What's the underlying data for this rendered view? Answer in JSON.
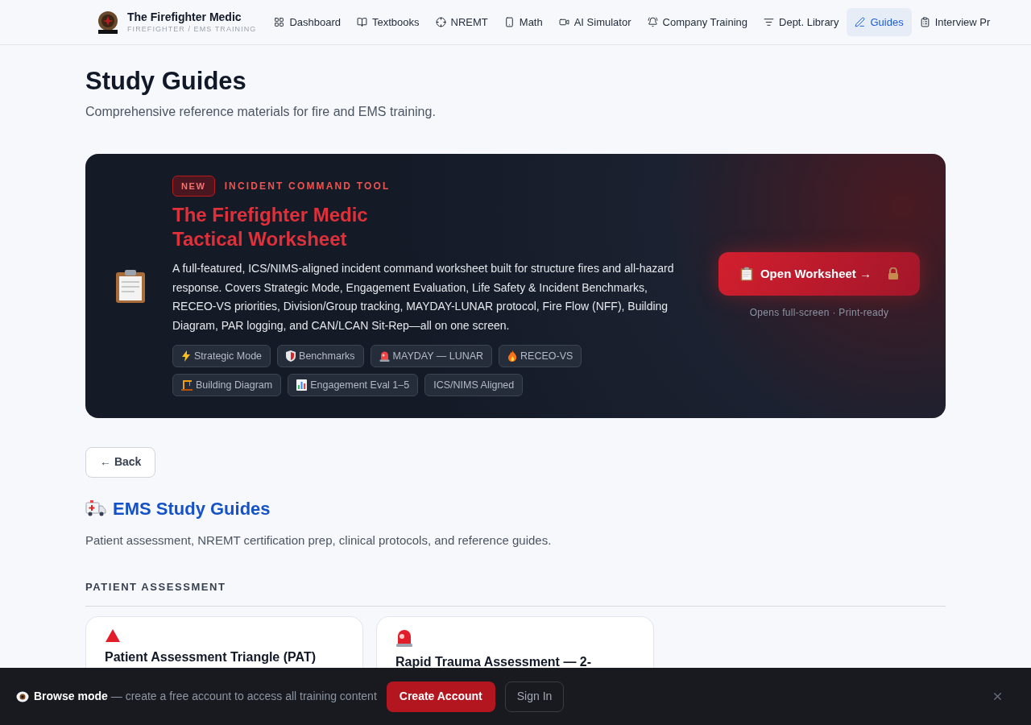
{
  "brand": {
    "title": "The Firefighter Medic",
    "subtitle": "FIREFIGHTER / EMS TRAINING"
  },
  "nav": [
    {
      "label": "Dashboard",
      "selected": false
    },
    {
      "label": "Textbooks",
      "selected": false
    },
    {
      "label": "NREMT",
      "selected": false
    },
    {
      "label": "Math",
      "selected": false
    },
    {
      "label": "AI Simulator",
      "selected": false
    },
    {
      "label": "Company Training",
      "selected": false
    },
    {
      "label": "Dept. Library",
      "selected": false
    },
    {
      "label": "Guides",
      "selected": true
    },
    {
      "label": "Interview Pr",
      "selected": false
    }
  ],
  "page": {
    "title": "Study Guides",
    "subtitle": "Comprehensive reference materials for fire and EMS training."
  },
  "promo": {
    "badge": "NEW",
    "eyebrow": "INCIDENT COMMAND TOOL",
    "title_lines": [
      "The Firefighter Medic",
      "Tactical Worksheet"
    ],
    "description": "A full-featured, ICS/NIMS-aligned incident command worksheet built for structure fires and all-hazard response. Covers Strategic Mode, Engagement Evaluation, Life Safety & Incident Benchmarks, RECEO-VS priorities, Division/Group tracking, MAYDAY-LUNAR protocol, Fire Flow (NFF), Building Diagram, PAR logging, and CAN/LCAN Sit-Rep—all on one screen.",
    "tags": [
      "Strategic Mode",
      "Benchmarks",
      "MAYDAY — LUNAR",
      "RECEO-VS",
      "Building Diagram",
      "Engagement Eval 1–5",
      "ICS/NIMS Aligned"
    ],
    "button": "Open Worksheet →",
    "note": "Opens full-screen · Print-ready"
  },
  "back_button": "← Back",
  "section": {
    "title": "EMS Study Guides",
    "subtitle": "Patient assessment, NREMT certification prep, clinical protocols, and reference guides.",
    "group": "PATIENT ASSESSMENT",
    "cards": [
      {
        "title": "Patient Assessment Triangle (PAT)"
      },
      {
        "title": "Rapid Trauma Assessment — 2-"
      }
    ]
  },
  "banner": {
    "lead": "Browse mode",
    "text": "— create a free account to access all training content",
    "primary": "Create Account",
    "secondary": "Sign In"
  }
}
